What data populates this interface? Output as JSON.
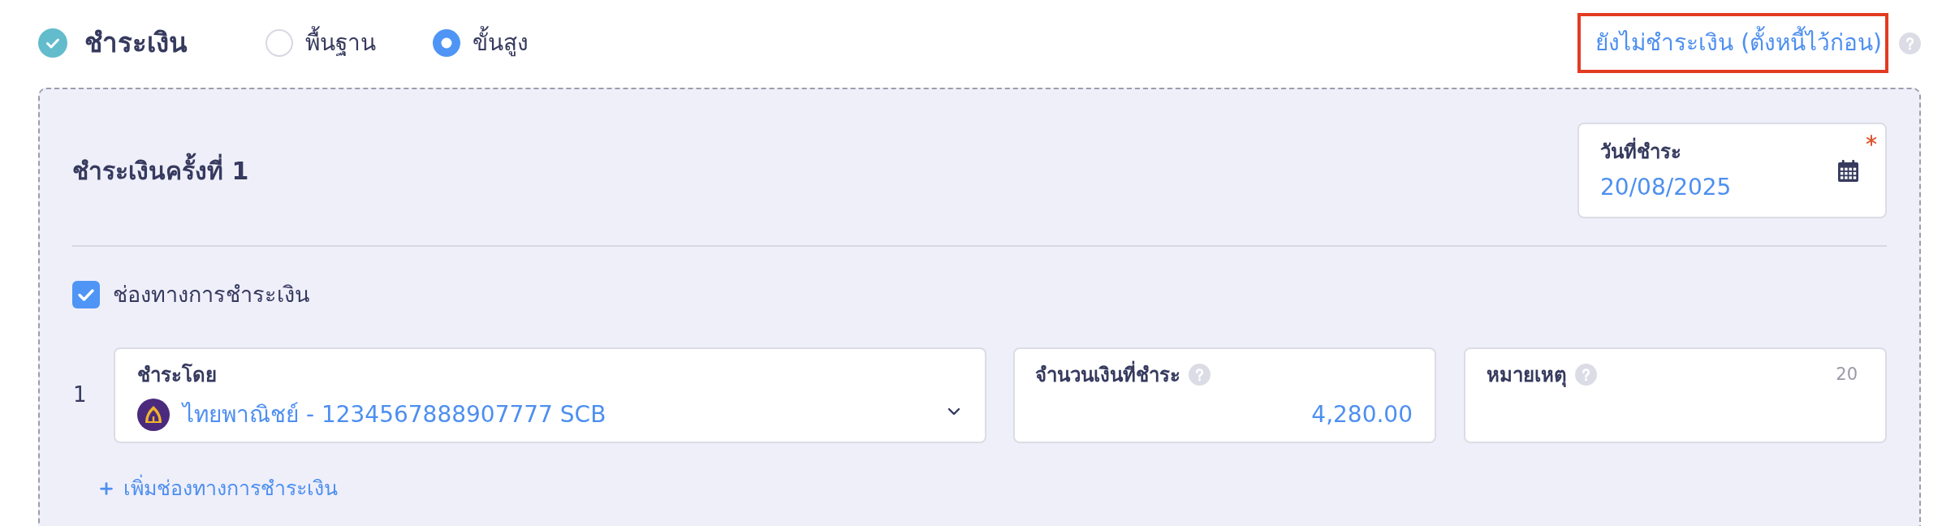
{
  "header": {
    "title": "ชำระเงิน",
    "completed": true,
    "modes": [
      {
        "label": "พื้นฐาน",
        "selected": false
      },
      {
        "label": "ขั้นสูง",
        "selected": true
      }
    ],
    "unpaid_link": {
      "label": "ยังไม่ชำระเงิน (ตั้งหนี้ไว้ก่อน)",
      "highlighted": true
    }
  },
  "payment": {
    "title": "ชำระเงินครั้งที่ 1",
    "date_field": {
      "label": "วันที่ชำระ",
      "value": "20/08/2025",
      "required": true
    },
    "channels_option": {
      "label": "ช่องทางการชำระเงิน",
      "checked": true
    },
    "channels": [
      {
        "index": "1",
        "pay_by": {
          "label": "ชำระโดย",
          "value": "ไทยพาณิชย์ - 1234567888907777 SCB"
        },
        "amount": {
          "label": "จำนวนเงินที่ชำระ",
          "value": "4,280.00"
        },
        "note": {
          "label": "หมายเหตุ",
          "counter": "20"
        }
      }
    ],
    "add_channel": {
      "label": "เพิ่มช่องทางการชำระเงิน"
    }
  }
}
